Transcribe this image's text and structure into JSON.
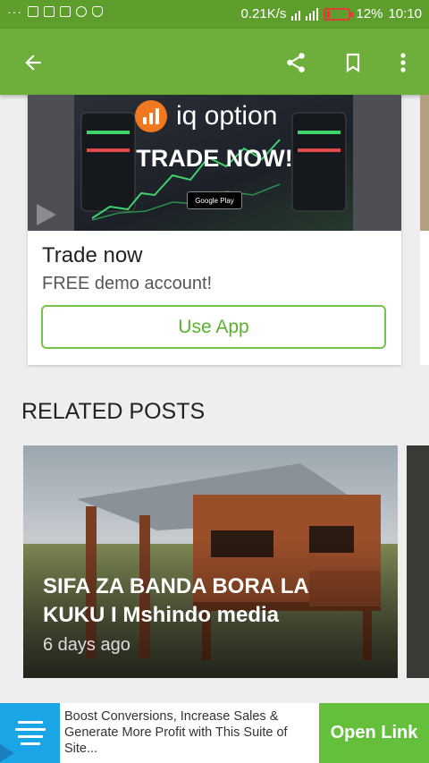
{
  "status_bar": {
    "net_speed": "0.21K/s",
    "battery": "12%",
    "battery_level": 0.12,
    "time": "10:10",
    "icons": [
      "more-dots-icon",
      "phone-icon",
      "image-icon",
      "gmail-icon",
      "whatsapp-icon",
      "shield-icon",
      "signal-icon",
      "battery-icon"
    ]
  },
  "app_bar": {
    "back_icon": "arrow-back-icon",
    "share_icon": "share-icon",
    "bookmark_icon": "bookmark-icon",
    "more_icon": "more-vert-icon"
  },
  "ad_card": {
    "brand": "iq option",
    "headline_image": "TRADE NOW!",
    "store_badge": "Google Play",
    "title": "Trade now",
    "subtitle": "FREE demo account!",
    "cta": "Use App",
    "accent": "#74c34a",
    "logo_color": "#f0791f"
  },
  "related": {
    "heading": "RELATED POSTS",
    "posts": [
      {
        "title": "SIFA ZA BANDA BORA LA KUKU I Mshindo media",
        "time": "6 days ago"
      }
    ]
  },
  "banner_ad": {
    "text": "Boost Conversions, Increase Sales & Generate More Profit with This Suite of Site...",
    "button": "Open Link",
    "icon": "menu-lines-icon",
    "color_icon_bg": "#1aa6e6",
    "color_button": "#64c03b"
  },
  "colors": {
    "status_bar": "#5e9e2d",
    "app_bar": "#6daf3a"
  }
}
